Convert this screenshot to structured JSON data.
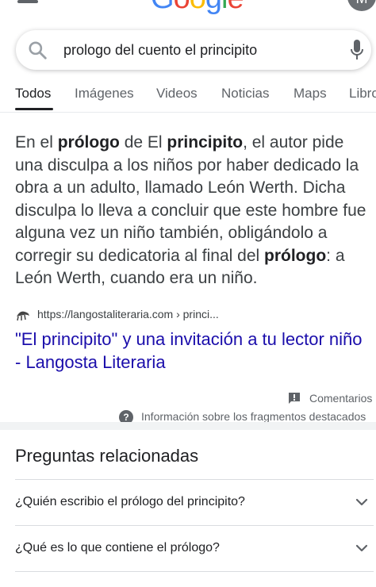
{
  "header": {
    "logo_text": "Google",
    "logo_colors": [
      "#4285F4",
      "#EA4335",
      "#FBBC05",
      "#4285F4",
      "#34A853",
      "#EA4335"
    ],
    "avatar_initial": "M"
  },
  "search": {
    "query": "prologo del cuento el principito"
  },
  "tabs": [
    {
      "label": "Todos",
      "active": true
    },
    {
      "label": "Imágenes"
    },
    {
      "label": "Videos"
    },
    {
      "label": "Noticias"
    },
    {
      "label": "Maps"
    },
    {
      "label": "Libro"
    }
  ],
  "snippet": {
    "segments": [
      {
        "text": "En el ",
        "bold": false
      },
      {
        "text": "prólogo",
        "bold": true
      },
      {
        "text": " de El ",
        "bold": false
      },
      {
        "text": "principito",
        "bold": true
      },
      {
        "text": ", el autor pide una disculpa a los niños por haber dedicado la obra a un adulto, llamado León Werth. Dicha disculpa lo lleva a concluir que este hombre fue alguna vez un niño también, obligándolo a corregir su dedicatoria al final del ",
        "bold": false
      },
      {
        "text": "prólogo",
        "bold": true
      },
      {
        "text": ": a León Werth, cuando era un niño.",
        "bold": false
      }
    ],
    "source_url": "https://langostaliteraria.com › princi...",
    "result_title": "\"El principito\" y una invitación a tu lector niño - Langosta Literaria",
    "feedback_label": "Comentarios",
    "info_label": "Información sobre los fragmentos destacados"
  },
  "related": {
    "title": "Preguntas relacionadas",
    "questions": [
      "¿Quién escribio el prólogo del principito?",
      "¿Qué es lo que contiene el prólogo?"
    ]
  },
  "colors": {
    "link": "#1a0dab",
    "text": "#202124",
    "muted": "#5f6368"
  }
}
